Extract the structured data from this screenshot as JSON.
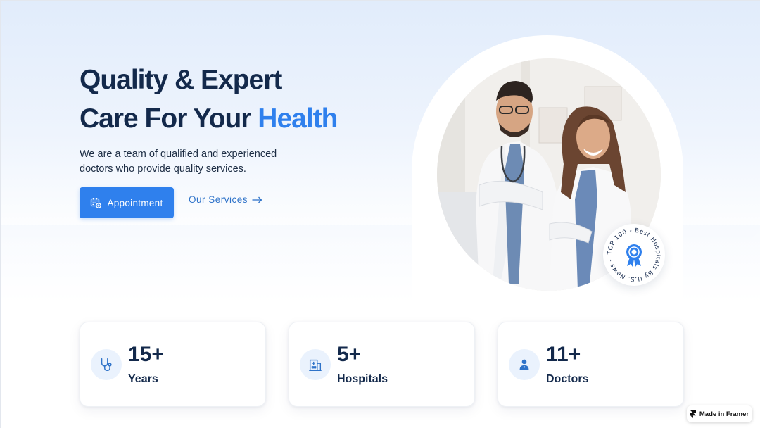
{
  "hero": {
    "title_line1": "Quality & Expert",
    "title_line2_prefix": "Care For Your",
    "title_line2_accent": "Health",
    "description": "We are a team of qualified and experienced doctors who provide quality services.",
    "appointment_label": "Appointment",
    "services_label": "Our Services"
  },
  "badge": {
    "text": "TOP 100 - Best Hospitals By U.S. News -",
    "icon": "award-ribbon-icon"
  },
  "stats": [
    {
      "value": "15+",
      "label": "Years",
      "icon": "stethoscope-icon"
    },
    {
      "value": "5+",
      "label": "Hospitals",
      "icon": "hospital-building-icon"
    },
    {
      "value": "11+",
      "label": "Doctors",
      "icon": "doctor-icon"
    }
  ],
  "framer": {
    "label": "Made in Framer",
    "icon": "framer-logo-icon"
  },
  "colors": {
    "accent": "#2f80ed",
    "heading": "#13294b",
    "icon_bg": "#eaf2fd"
  }
}
